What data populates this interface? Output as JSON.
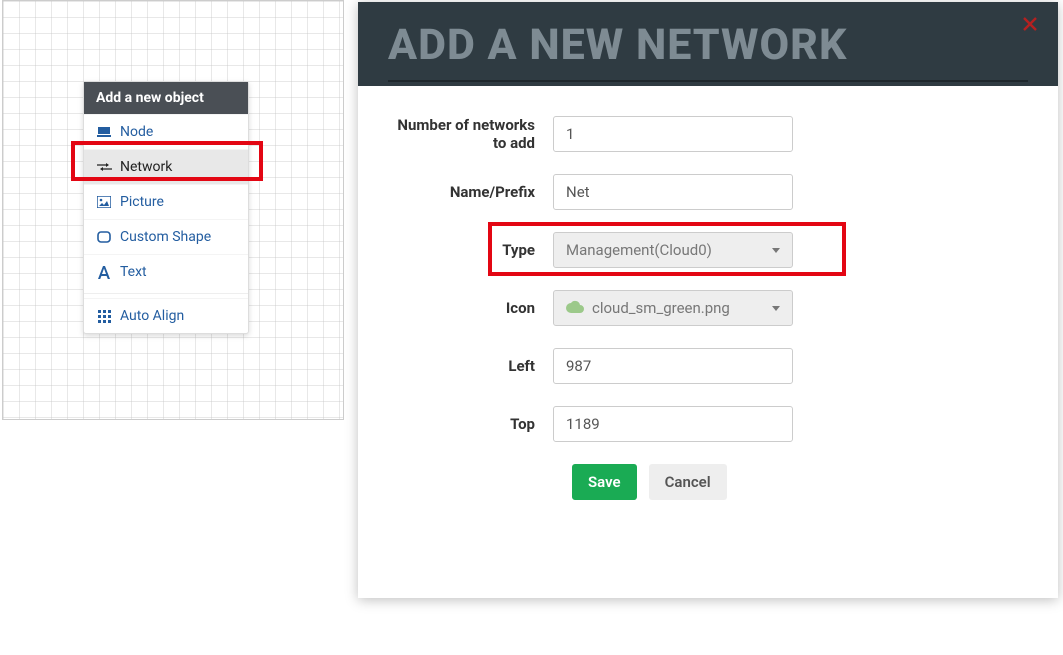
{
  "context_menu": {
    "header": "Add a new object",
    "items": [
      {
        "label": "Node",
        "icon": "node-icon"
      },
      {
        "label": "Network",
        "icon": "network-icon",
        "selected": true
      },
      {
        "label": "Picture",
        "icon": "picture-icon"
      },
      {
        "label": "Custom Shape",
        "icon": "shape-icon"
      },
      {
        "label": "Text",
        "icon": "text-icon"
      },
      {
        "label": "Auto Align",
        "icon": "grid-icon",
        "separator_before": true
      }
    ]
  },
  "modal": {
    "title": "ADD A NEW NETWORK",
    "close_tooltip": "Close",
    "fields": {
      "count_label": "Number of networks to add",
      "count_value": "1",
      "name_label": "Name/Prefix",
      "name_value": "Net",
      "type_label": "Type",
      "type_value": "Management(Cloud0)",
      "icon_label": "Icon",
      "icon_value": "cloud_sm_green.png",
      "left_label": "Left",
      "left_value": "987",
      "top_label": "Top",
      "top_value": "1189"
    },
    "buttons": {
      "save": "Save",
      "cancel": "Cancel"
    },
    "highlight_field": "type"
  }
}
